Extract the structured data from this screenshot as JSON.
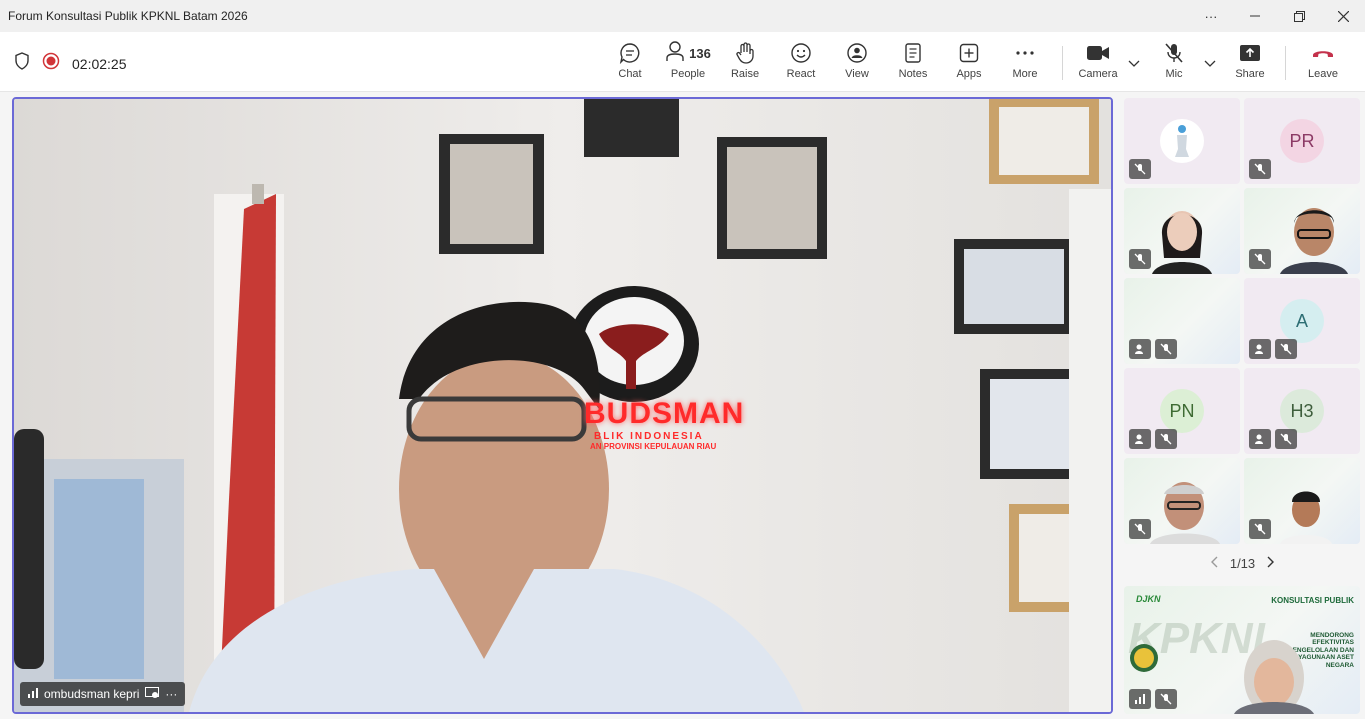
{
  "window": {
    "title": "Forum Konsultasi Publik KPKNL Batam 2026"
  },
  "meeting": {
    "timer": "02:02:25"
  },
  "toolbar": {
    "chat": "Chat",
    "people_count": "136",
    "people": "People",
    "raise": "Raise",
    "react": "React",
    "view": "View",
    "notes": "Notes",
    "apps": "Apps",
    "more": "More",
    "camera": "Camera",
    "mic": "Mic",
    "share": "Share",
    "leave": "Leave"
  },
  "stage": {
    "speaker_name": "ombudsman kepri",
    "sign_main": "BUDSMAN",
    "sign_line1": "BLIK INDONESIA",
    "sign_line2": "AN PROVINSI KEPULAUAN RIAU"
  },
  "gallery": {
    "tiles": [
      {
        "initials": "",
        "type": "image-avatar"
      },
      {
        "initials": "PR",
        "type": "initials"
      },
      {
        "initials": "",
        "type": "video"
      },
      {
        "initials": "",
        "type": "video"
      },
      {
        "initials": "",
        "type": "slide"
      },
      {
        "initials": "A",
        "type": "initials"
      },
      {
        "initials": "PN",
        "type": "initials"
      },
      {
        "initials": "H3",
        "type": "initials"
      },
      {
        "initials": "",
        "type": "video"
      },
      {
        "initials": "",
        "type": "video"
      }
    ],
    "page": "1/13"
  },
  "self_view": {
    "slide_title": "KONSULTASI PUBLIK",
    "slide_subtitle": "MENDORONG EFEKTIVITAS PENGELOLAAN DAN PENDAYAGUNAAN ASET NEGARA",
    "brand": "DJKN",
    "watermark": "KPKNL"
  },
  "colors": {
    "accent": "#6b69d6",
    "leave": "#c4314b",
    "record": "#d13438"
  }
}
